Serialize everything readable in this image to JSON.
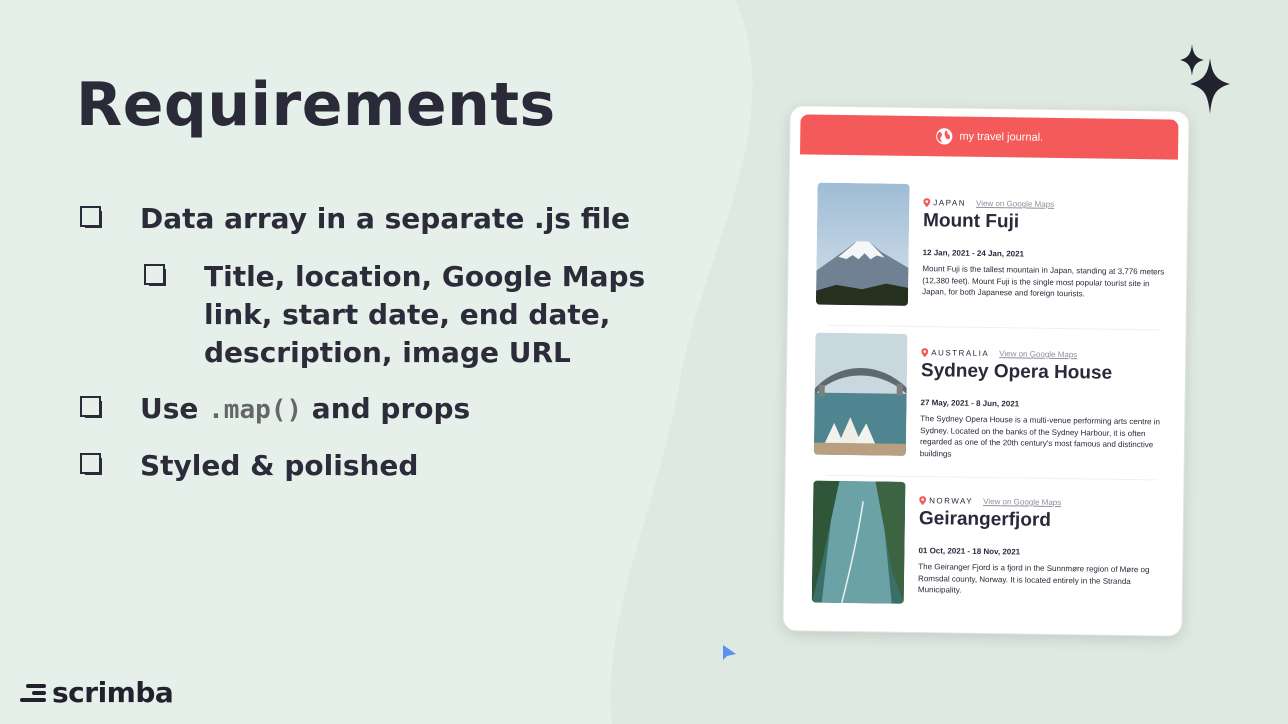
{
  "slide": {
    "title": "Requirements",
    "items": [
      {
        "text": "Data array in a separate .js file"
      },
      {
        "text": "Title, location, Google Maps link, start date, end date, description, image URL"
      },
      {
        "prefix": "Use ",
        "code": ".map()",
        "suffix": " and props"
      },
      {
        "text": "Styled & polished"
      }
    ],
    "logo": "scrimba"
  },
  "app": {
    "brand": "my travel journal.",
    "header_color": "#f55a5a",
    "maps_link_label": "View on Google Maps",
    "entries": [
      {
        "location": "JAPAN",
        "title": "Mount Fuji",
        "dates": "12 Jan, 2021 - 24 Jan, 2021",
        "description": "Mount Fuji is the tallest mountain in Japan, standing at 3,776 meters (12,380 feet). Mount Fuji is the single most popular tourist site in Japan, for both Japanese and foreign tourists."
      },
      {
        "location": "AUSTRALIA",
        "title": "Sydney Opera House",
        "dates": "27 May, 2021 - 8 Jun, 2021",
        "description": "The Sydney Opera House is a multi-venue performing arts centre in Sydney. Located on the banks of the Sydney Harbour, it is often regarded as one of the 20th century's most famous and distinctive buildings"
      },
      {
        "location": "NORWAY",
        "title": "Geirangerfjord",
        "dates": "01 Oct, 2021 - 18 Nov, 2021",
        "description": "The Geiranger Fjord is a fjord in the Sunnmøre region of Møre og Romsdal county, Norway. It is located entirely in the Stranda Municipality."
      }
    ]
  }
}
